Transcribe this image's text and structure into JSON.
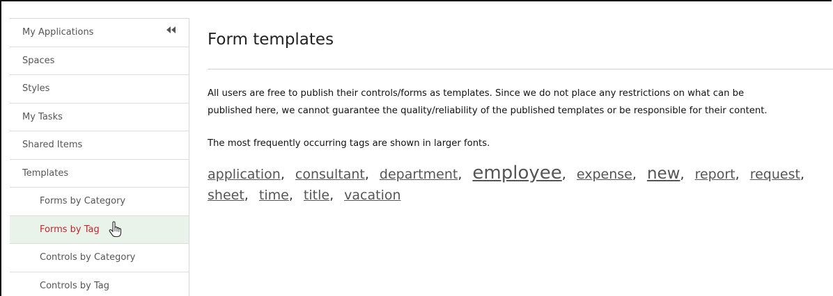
{
  "sidebar": {
    "items": [
      {
        "label": "My Applications"
      },
      {
        "label": "Spaces"
      },
      {
        "label": "Styles"
      },
      {
        "label": "My Tasks"
      },
      {
        "label": "Shared Items"
      },
      {
        "label": "Templates"
      },
      {
        "label": "Forms by Category"
      },
      {
        "label": "Forms by Tag"
      },
      {
        "label": "Controls by Category"
      },
      {
        "label": "Controls by Tag"
      }
    ],
    "active_item": "Forms by Tag",
    "active_color": "#c1272d",
    "active_background": "#eaf3e9"
  },
  "main": {
    "title": "Form templates",
    "paragraph1_line1": "All users are free to publish their controls/forms as templates. Since we do not place any restrictions on what can be",
    "paragraph1_line2": "published here, we cannot guarantee the quality/reliability of the published templates or be responsible for their content.",
    "paragraph2": "The most frequently occurring tags are shown in larger fonts.",
    "tags": [
      {
        "label": "application",
        "size": "normal"
      },
      {
        "label": "consultant",
        "size": "normal"
      },
      {
        "label": "department",
        "size": "normal"
      },
      {
        "label": "employee",
        "size": "large"
      },
      {
        "label": "expense",
        "size": "normal"
      },
      {
        "label": "new",
        "size": "medium"
      },
      {
        "label": "report",
        "size": "normal"
      },
      {
        "label": "request",
        "size": "normal"
      },
      {
        "label": "sheet",
        "size": "normal"
      },
      {
        "label": "time",
        "size": "normal"
      },
      {
        "label": "title",
        "size": "normal"
      },
      {
        "label": "vacation",
        "size": "normal"
      }
    ],
    "separator": ","
  },
  "icons": {
    "collapse": "double-chevron-left-icon",
    "cursor": "hand-pointer-icon"
  }
}
